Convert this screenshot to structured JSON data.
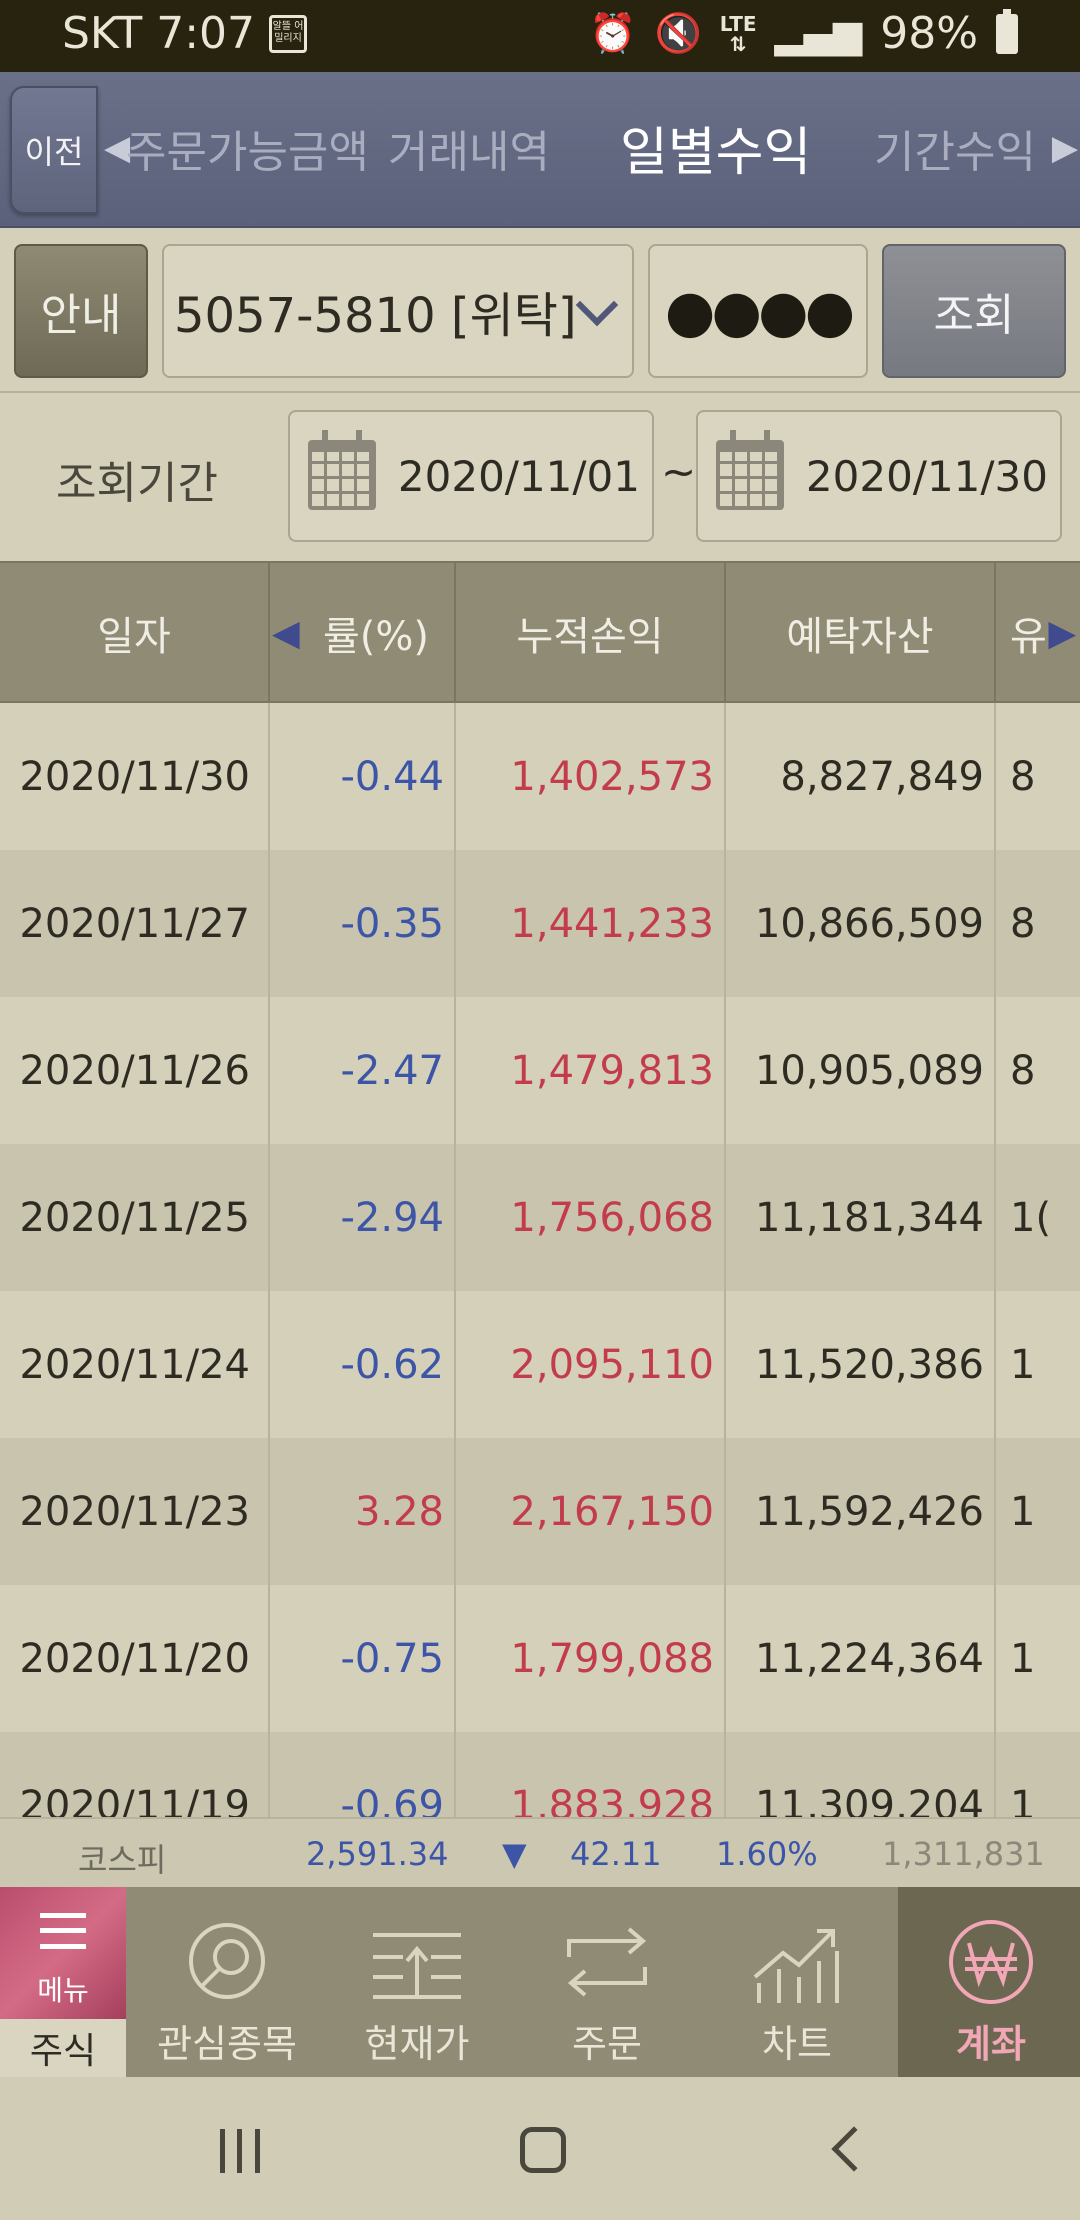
{
  "status_bar": {
    "carrier_time": "SKT 7:07",
    "app_icon_text": "알뜰 어밀리지",
    "network": "LTE",
    "battery": "98%"
  },
  "tabs": {
    "prev_label": "이전",
    "items": [
      "주문가능금액",
      "거래내역",
      "일별수익",
      "기간수익"
    ],
    "active": "일별수익"
  },
  "account": {
    "info_label": "안내",
    "account_value": "5057-5810 [위탁]",
    "password_mask": "●●●●",
    "search_label": "조회"
  },
  "period": {
    "label": "조회기간",
    "start": "2020/11/01",
    "separator": "~",
    "end": "2020/11/30"
  },
  "table": {
    "headers": [
      "일자",
      "률(%)",
      "누적손익",
      "예탁자산",
      "유"
    ],
    "rows": [
      {
        "date": "2020/11/30",
        "rate": "-0.44",
        "rate_dir": "neg",
        "cum": "1,402,573",
        "deposit": "8,827,849",
        "eval": "8"
      },
      {
        "date": "2020/11/27",
        "rate": "-0.35",
        "rate_dir": "neg",
        "cum": "1,441,233",
        "deposit": "10,866,509",
        "eval": "8"
      },
      {
        "date": "2020/11/26",
        "rate": "-2.47",
        "rate_dir": "neg",
        "cum": "1,479,813",
        "deposit": "10,905,089",
        "eval": "8"
      },
      {
        "date": "2020/11/25",
        "rate": "-2.94",
        "rate_dir": "neg",
        "cum": "1,756,068",
        "deposit": "11,181,344",
        "eval": "1("
      },
      {
        "date": "2020/11/24",
        "rate": "-0.62",
        "rate_dir": "neg",
        "cum": "2,095,110",
        "deposit": "11,520,386",
        "eval": "1"
      },
      {
        "date": "2020/11/23",
        "rate": "3.28",
        "rate_dir": "pos",
        "cum": "2,167,150",
        "deposit": "11,592,426",
        "eval": "1"
      },
      {
        "date": "2020/11/20",
        "rate": "-0.75",
        "rate_dir": "neg",
        "cum": "1,799,088",
        "deposit": "11,224,364",
        "eval": "1"
      },
      {
        "date": "2020/11/19",
        "rate": "-0.69",
        "rate_dir": "neg",
        "cum": "1,883,928",
        "deposit": "11,309,204",
        "eval": "1"
      }
    ]
  },
  "ticker": {
    "label": "코스피",
    "index": "2,591.34",
    "arrow": "▼",
    "change": "42.11",
    "percent": "1.60%",
    "volume": "1,311,831"
  },
  "bottom_nav": {
    "menu_label": "메뉴",
    "stock_label": "주식",
    "items": [
      "관심종목",
      "현재가",
      "주문",
      "차트",
      "계좌"
    ],
    "active": "계좌"
  },
  "colors": {
    "negative": "#3c55a6",
    "positive": "#c23c4c",
    "header_bg": "#5b617a",
    "active_nav": "#f1a7b6"
  }
}
